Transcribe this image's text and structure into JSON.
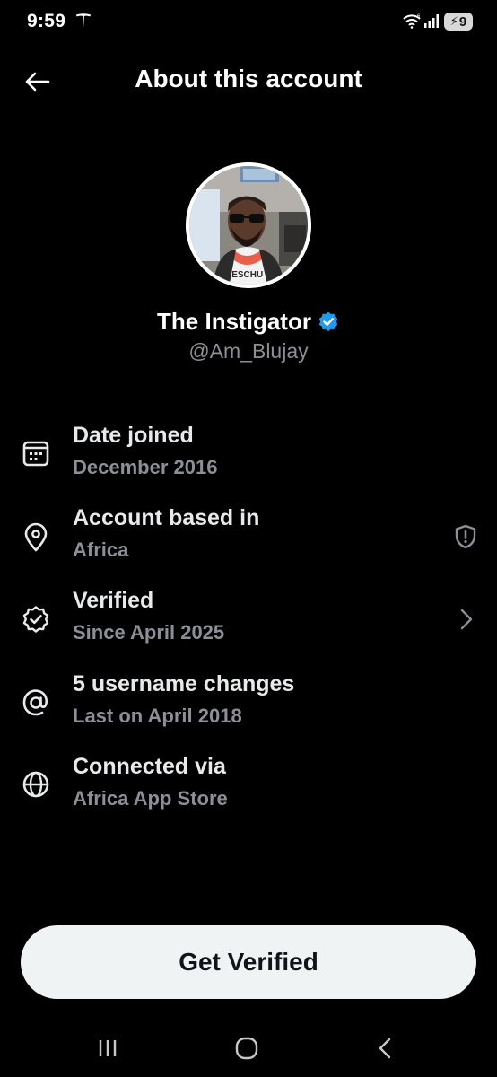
{
  "status_bar": {
    "time": "9:59",
    "battery_level": "9"
  },
  "header": {
    "title": "About this account"
  },
  "profile": {
    "display_name": "The Instigator",
    "username": "@Am_Blujay",
    "verified": true,
    "avatar_jersey_text": "DESCHU"
  },
  "info": {
    "date_joined": {
      "label": "Date joined",
      "value": "December 2016"
    },
    "based_in": {
      "label": "Account based in",
      "value": "Africa"
    },
    "verified": {
      "label": "Verified",
      "value": "Since April 2025"
    },
    "username_changes": {
      "label": "5 username changes",
      "value": "Last on April 2018"
    },
    "connected": {
      "label": "Connected via",
      "value": "Africa App Store"
    }
  },
  "cta": {
    "label": "Get Verified"
  },
  "colors": {
    "background": "#000000",
    "primary_text": "#e7e9ea",
    "secondary_text": "#8b9096",
    "verified_blue": "#1d9bf0",
    "button_bg": "#eff3f4",
    "button_text": "#0f1419"
  },
  "icons": {
    "back": "arrow-left-icon",
    "date_joined": "calendar-icon",
    "based_in": "location-pin-icon",
    "based_in_trailing": "shield-alert-icon",
    "verified": "verified-check-icon",
    "verified_trailing": "chevron-right-icon",
    "username_changes": "at-sign-icon",
    "connected": "globe-icon"
  }
}
